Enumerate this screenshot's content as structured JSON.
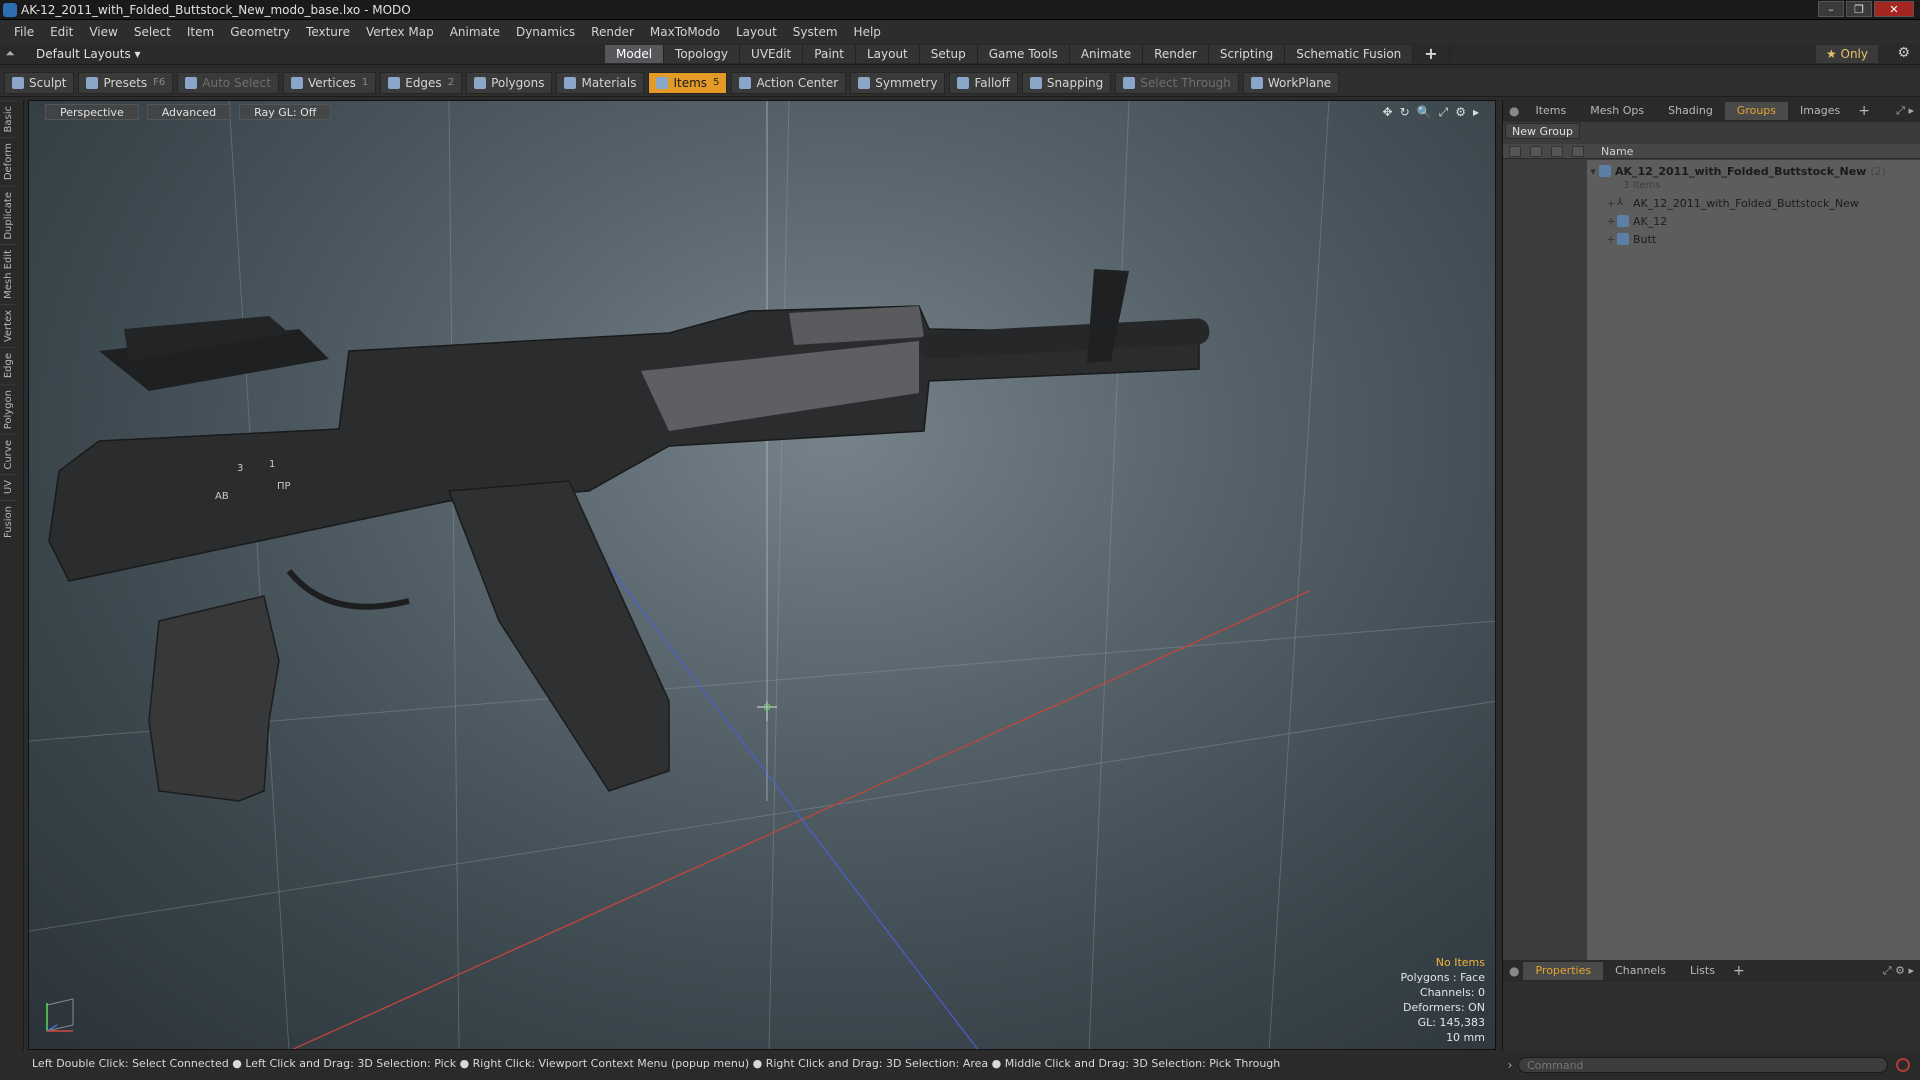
{
  "window": {
    "title": "AK-12_2011_with_Folded_Buttstock_New_modo_base.lxo - MODO",
    "controls": [
      "–",
      "❐",
      "✕"
    ]
  },
  "menu": [
    "File",
    "Edit",
    "View",
    "Select",
    "Item",
    "Geometry",
    "Texture",
    "Vertex Map",
    "Animate",
    "Dynamics",
    "Render",
    "MaxToModo",
    "Layout",
    "System",
    "Help"
  ],
  "layoutbar": {
    "layout_select": "Default Layouts ▾",
    "tabs": [
      "Model",
      "Topology",
      "UVEdit",
      "Paint",
      "Layout",
      "Setup",
      "Game Tools",
      "Animate",
      "Render",
      "Scripting",
      "Schematic Fusion"
    ],
    "active_tab": "Model",
    "plus": "+",
    "only": "★ Only",
    "gear": "⚙"
  },
  "toolbar": {
    "sculpt": "Sculpt",
    "presets": "Presets",
    "presets_key": "F6",
    "auto_select": "Auto Select",
    "vertices": "Vertices",
    "vertices_key": "1",
    "edges": "Edges",
    "edges_key": "2",
    "polygons": "Polygons",
    "materials": "Materials",
    "items": "Items",
    "items_key": "5",
    "action_center": "Action Center",
    "symmetry": "Symmetry",
    "falloff": "Falloff",
    "snapping": "Snapping",
    "select_through": "Select Through",
    "workplane": "WorkPlane"
  },
  "left_tabs": [
    "Basic",
    "Deform",
    "Duplicate",
    "Mesh Edit",
    "Vertex",
    "Edge",
    "Polygon",
    "Curve",
    "UV",
    "Fusion"
  ],
  "viewport": {
    "buttons": [
      "Perspective",
      "Advanced",
      "Ray GL: Off"
    ],
    "icons": [
      "✥",
      "↻",
      "🔍",
      "⤢",
      "⚙",
      "▸"
    ],
    "info": {
      "no_items": "No Items",
      "polygons": "Polygons : Face",
      "channels": "Channels: 0",
      "deformers": "Deformers: ON",
      "gl": "GL: 145,383",
      "scale": "10 mm"
    },
    "model_markings": [
      "3",
      "1",
      "AB",
      "ПР"
    ]
  },
  "right_panel": {
    "top_tabs": [
      "Items",
      "Mesh Ops",
      "Shading",
      "Groups",
      "Images"
    ],
    "active_top_tab": "Groups",
    "new_group": "New Group",
    "name_header": "Name",
    "tree": {
      "root_name": "AK_12_2011_with_Folded_Buttstock_New",
      "root_count": "(2)",
      "root_sub": "3 Items",
      "children": [
        {
          "name": "AK_12_2011_with_Folded_Buttstock_New",
          "icon": "locator-icon"
        },
        {
          "name": "AK_12",
          "icon": "mesh-icon"
        },
        {
          "name": "Butt",
          "icon": "mesh-icon"
        }
      ]
    },
    "bottom_tabs": [
      "Properties",
      "Channels",
      "Lists"
    ],
    "active_bottom_tab": "Properties"
  },
  "statusbar": "Left Double Click: Select Connected ● Left Click and Drag: 3D Selection: Pick ● Right Click: Viewport Context Menu (popup menu) ● Right Click and Drag: 3D Selection: Area ● Middle Click and Drag: 3D Selection: Pick Through",
  "command": {
    "placeholder": "Command"
  },
  "colors": {
    "accent": "#e39a27",
    "active_tab_text": "#e6a432",
    "info_highlight": "#f0b53a"
  }
}
